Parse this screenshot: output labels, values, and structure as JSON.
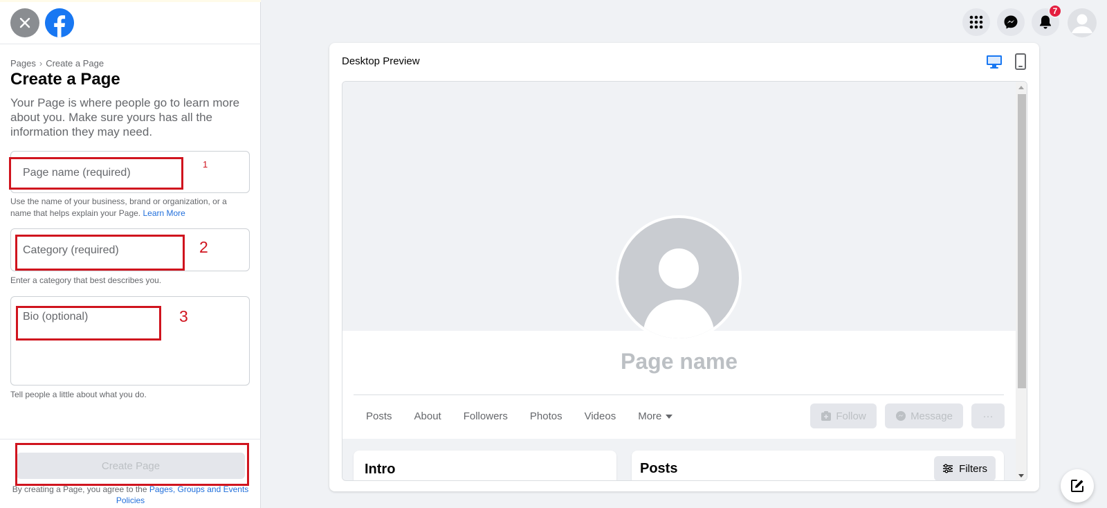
{
  "sidebar": {
    "breadcrumb": [
      "Pages",
      "Create a Page"
    ],
    "title": "Create a Page",
    "intro": "Your Page is where people go to learn more about you. Make sure yours has all the information they may need.",
    "fields": {
      "page_name": {
        "placeholder": "Page name (required)",
        "help": "Use the name of your business, brand or organization, or a name that helps explain your Page.",
        "help_link": "Learn More"
      },
      "category": {
        "placeholder": "Category (required)",
        "help": "Enter a category that best describes you."
      },
      "bio": {
        "placeholder": "Bio (optional)",
        "help": "Tell people a little about what you do."
      }
    },
    "create_button": "Create Page",
    "terms_prefix": "By creating a Page, you agree to the",
    "terms_link": "Pages, Groups and Events Policies"
  },
  "annotations": [
    "1",
    "2",
    "3"
  ],
  "topnav": {
    "notification_count": "7"
  },
  "preview": {
    "label": "Desktop Preview",
    "page_name": "Page name",
    "tabs": [
      "Posts",
      "About",
      "Followers",
      "Photos",
      "Videos",
      "More"
    ],
    "actions": {
      "follow": "Follow",
      "message": "Message",
      "more": "···"
    },
    "intro_title": "Intro",
    "posts_title": "Posts",
    "filters": "Filters"
  },
  "colors": {
    "brand": "#1877f2",
    "annotation": "#d0141e",
    "badge": "#e41e3f",
    "link": "#216fdb"
  },
  "icons": [
    "close-icon",
    "facebook-logo-icon",
    "menu-grid-icon",
    "messenger-icon",
    "bell-icon",
    "user-avatar-icon",
    "desktop-icon",
    "mobile-icon",
    "caret-down-icon",
    "follow-icon",
    "messenger-small-icon",
    "filters-icon",
    "compose-icon"
  ]
}
